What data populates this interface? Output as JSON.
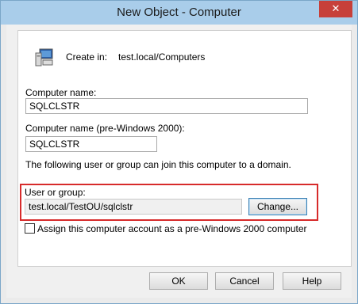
{
  "window": {
    "title": "New Object - Computer",
    "close_glyph": "✕"
  },
  "header": {
    "icon": "computer-icon",
    "create_in_label": "Create in:",
    "create_in_value": "test.local/Computers"
  },
  "form": {
    "computer_name_label": "Computer name:",
    "computer_name_value": "SQLCLSTR",
    "pre2000_label": "Computer name (pre-Windows 2000):",
    "pre2000_value": "SQLCLSTR",
    "join_note": "The following user or group can join this computer to a domain.",
    "user_group_label": "User or group:",
    "user_group_value": "test.local/TestOU/sqlclstr",
    "change_button": "Change...",
    "pre2000_checkbox_label": "Assign this computer account as a pre-Windows 2000 computer",
    "pre2000_checkbox_checked": false
  },
  "buttons": {
    "ok": "OK",
    "cancel": "Cancel",
    "help": "Help"
  },
  "colors": {
    "titlebar": "#a9cdea",
    "close": "#c7403a",
    "highlight": "#d72b2b"
  }
}
